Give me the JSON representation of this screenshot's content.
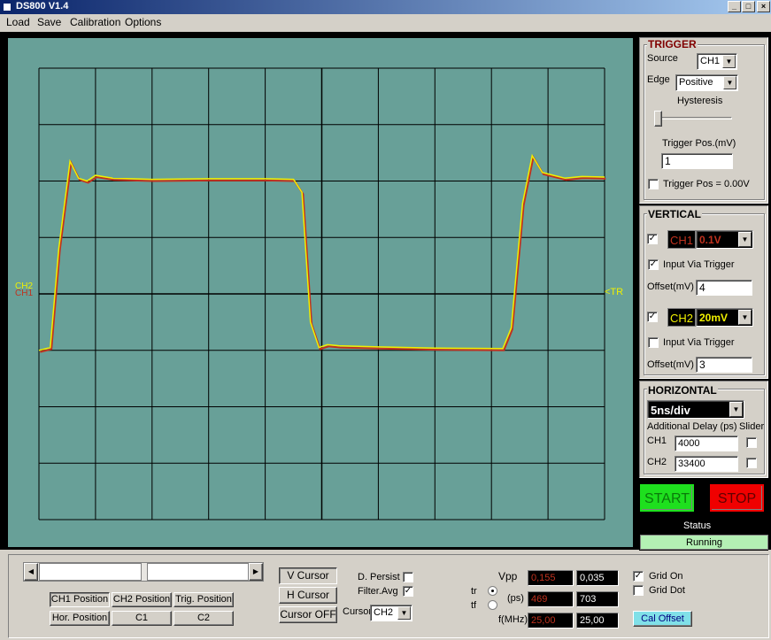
{
  "window": {
    "title": "DS800 V1.4",
    "controls": [
      "_",
      "□",
      "×"
    ]
  },
  "menu": [
    "Load",
    "Save",
    "Calibration",
    "Options"
  ],
  "scope": {
    "ch2_marker": "CH2",
    "ch1_marker": "CH1",
    "trig_marker": "<TR",
    "colors": {
      "background": "#68a098",
      "grid": "#000000",
      "ch1": "#c0321e",
      "ch2": "#f0f000"
    }
  },
  "trigger": {
    "title": "TRIGGER",
    "source_label": "Source",
    "source_value": "CH1",
    "edge_label": "Edge",
    "edge_value": "Positive",
    "hysteresis_label": "Hysteresis",
    "hysteresis_level": 0.0,
    "trigger_pos_label": "Trigger Pos.(mV)",
    "trigger_pos_value": "1",
    "trigger_zero_label": "Trigger Pos = 0.00V",
    "trigger_zero_checked": false
  },
  "vertical": {
    "title": "VERTICAL",
    "ch1_label": "CH1",
    "ch1_scale": "0.1V",
    "ch1_enabled": true,
    "ch1_input_via_trigger_label": "Input Via Trigger",
    "ch1_input_via_trigger": true,
    "ch1_offset_label": "Offset(mV)",
    "ch1_offset": "4",
    "ch2_label": "CH2",
    "ch2_scale": "20mV",
    "ch2_enabled": true,
    "ch2_input_via_trigger_label": "Input Via Trigger",
    "ch2_input_via_trigger": false,
    "ch2_offset_label": "Offset(mV)",
    "ch2_offset": "3"
  },
  "horizontal": {
    "title": "HORIZONTAL",
    "timebase": "5ns/div",
    "delay_label": "Additional Delay (ps)",
    "slider_label": "Slider",
    "ch1_label": "CH1",
    "ch1_delay": "4000",
    "ch2_label": "CH2",
    "ch2_delay": "33400"
  },
  "run": {
    "start": "START",
    "stop": "STOP",
    "status_label": "Status",
    "status_value": "Running"
  },
  "bottom": {
    "ch1_position": "CH1 Position",
    "ch2_position": "CH2 Position",
    "trig_position": "Trig. Position",
    "hor_position": "Hor. Position",
    "c1": "C1",
    "c2": "C2",
    "v_cursor": "V Cursor",
    "h_cursor": "H Cursor",
    "cursor_off": "Cursor OFF",
    "d_persist": "D. Persist",
    "d_persist_checked": false,
    "filter_avg": "Filter.Avg",
    "filter_avg_checked": true,
    "cursor_label": "Cursor",
    "cursor_value": "CH2",
    "vpp_label": "Vpp",
    "tr_label": "tr",
    "tf_label": "tf",
    "ps_label": "(ps)",
    "fmhz_label": "f(MHz)",
    "vpp_ch1": "0,155",
    "vpp_ch2": "0,035",
    "ps_ch1": "469",
    "ps_ch2": "703",
    "f_ch1": "25,00",
    "f_ch2": "25,00",
    "grid_on": "Grid On",
    "grid_on_checked": true,
    "grid_dot": "Grid Dot",
    "grid_dot_checked": false,
    "cal_offset": "Cal Offset"
  }
}
